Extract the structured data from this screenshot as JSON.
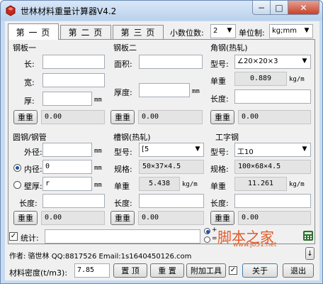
{
  "window": {
    "title": "世林材料重量计算器V4.2",
    "min": "−",
    "max": "□",
    "close": "✕"
  },
  "tabs": [
    {
      "label": "第 一 页"
    },
    {
      "label": "第 二 页"
    },
    {
      "label": "第 三 页"
    }
  ],
  "decimals": {
    "label": "小数位数:",
    "value": "2"
  },
  "unit_system": {
    "label": "单位制:",
    "value": "kg;mm"
  },
  "steel_plate_1": {
    "title": "钢板一",
    "length_label": "长:",
    "width_label": "宽:",
    "thickness_label": "厚:",
    "thickness_unit": "mm",
    "weight_button": "重重",
    "weight_value": "0.00"
  },
  "steel_plate_2": {
    "title": "钢板二",
    "area_label": "面积:",
    "thickness_label": "厚度:",
    "thickness_unit": "mm",
    "weight_button": "重重",
    "weight_value": "0.00"
  },
  "angle_steel": {
    "title": "角钢(热轧)",
    "model_label": "型号:",
    "model_value": "∠20×20×3",
    "unit_weight_label": "单重",
    "unit_weight_value": "0.889",
    "unit_weight_unit": "kg/m",
    "length_label": "长度:",
    "weight_button": "重重",
    "weight_value": "0.00"
  },
  "round_tube": {
    "title": "圆钢/钢管",
    "outer_label": "外径:",
    "outer_unit": "mm",
    "inner_label": "内径:",
    "inner_value": "0",
    "inner_unit": "mm",
    "wall_label": "壁厚:",
    "wall_value": "r",
    "wall_unit": "mm",
    "length_label": "长度:",
    "weight_button": "重重",
    "weight_value": "0.00"
  },
  "channel_steel": {
    "title": "槽钢(热轧)",
    "model_label": "型号:",
    "model_value": "[5",
    "spec_label": "规格:",
    "spec_value": "50×37×4.5",
    "unit_weight_label": "单重",
    "unit_weight_value": "5.438",
    "unit_weight_unit": "kg/m",
    "length_label": "长度:",
    "weight_button": "重重",
    "weight_value": "0.00"
  },
  "i_beam": {
    "title": "工字钢",
    "model_label": "型号:",
    "model_value": "工10",
    "spec_label": "规格:",
    "spec_value": "100×68×4.5",
    "unit_weight_label": "单重",
    "unit_weight_value": "11.261",
    "unit_weight_unit": "kg/m",
    "length_label": "长度:",
    "weight_button": "重重",
    "weight_value": "0.00"
  },
  "stats": {
    "label": "统计:",
    "checked": "✓",
    "total_value": "",
    "mode_plus": "+",
    "mode_eq": "="
  },
  "author": {
    "text": "作者: 骆世林 QQ:8817526  Email:1s1640450126.com"
  },
  "density": {
    "label": "材料密度(t/m3):",
    "value": "7.85"
  },
  "buttons": {
    "top": "置 顶",
    "reset": "重 置",
    "extra": "附加工具",
    "extra_check": "✓",
    "about": "关于",
    "exit": "退出",
    "scroll": "↓"
  },
  "watermark": {
    "text": "脚本之家",
    "url": "www.jb51.net"
  },
  "colors": {
    "title_bg": "#c6dbf1",
    "close_red": "#c6412a",
    "watermark": "#e05a2a"
  }
}
